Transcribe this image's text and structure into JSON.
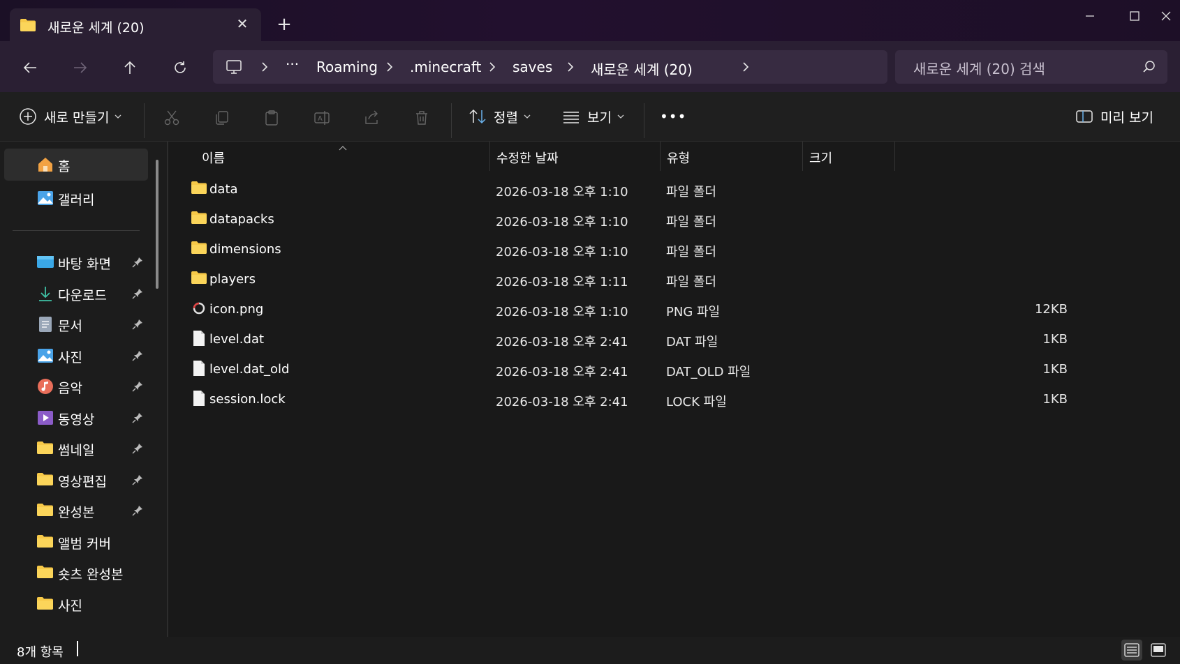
{
  "tab": {
    "title": "새로운 세계 (20)",
    "close": "✕",
    "new": "+"
  },
  "address": {
    "ellipsis": "···",
    "crumbs": [
      "Roaming",
      ".minecraft",
      "saves",
      "새로운 세계 (20)"
    ]
  },
  "search": {
    "placeholder": "새로운 세계 (20) 검색"
  },
  "toolbar": {
    "new_label": "새로 만들기",
    "sort_label": "정렬",
    "view_label": "보기",
    "more_label": "•••",
    "preview_label": "미리 보기"
  },
  "sidebar": {
    "items": [
      {
        "label": "홈",
        "icon": "home-icon",
        "pinned": false
      },
      {
        "label": "갤러리",
        "icon": "gallery-icon",
        "pinned": false
      },
      {
        "label": "바탕 화면",
        "icon": "desktop-icon",
        "pinned": true
      },
      {
        "label": "다운로드",
        "icon": "download-icon",
        "pinned": true
      },
      {
        "label": "문서",
        "icon": "documents-icon",
        "pinned": true
      },
      {
        "label": "사진",
        "icon": "pictures-icon",
        "pinned": true
      },
      {
        "label": "음악",
        "icon": "music-icon",
        "pinned": true
      },
      {
        "label": "동영상",
        "icon": "videos-icon",
        "pinned": true
      },
      {
        "label": "썸네일",
        "icon": "folder-icon",
        "pinned": true
      },
      {
        "label": "영상편집",
        "icon": "folder-icon",
        "pinned": true
      },
      {
        "label": "완성본",
        "icon": "folder-icon",
        "pinned": true
      },
      {
        "label": "앨범 커버",
        "icon": "folder-icon",
        "pinned": false
      },
      {
        "label": "숏츠 완성본",
        "icon": "folder-icon",
        "pinned": false
      },
      {
        "label": "사진",
        "icon": "folder-icon",
        "pinned": false
      }
    ]
  },
  "columns": {
    "name": "이름",
    "date": "수정한 날짜",
    "type": "유형",
    "size": "크기"
  },
  "files": [
    {
      "name": "data",
      "date": "2026-03-18 오후 1:10",
      "type": "파일 폴더",
      "size": "",
      "icon": "folder-icon"
    },
    {
      "name": "datapacks",
      "date": "2026-03-18 오후 1:10",
      "type": "파일 폴더",
      "size": "",
      "icon": "folder-icon"
    },
    {
      "name": "dimensions",
      "date": "2026-03-18 오후 1:10",
      "type": "파일 폴더",
      "size": "",
      "icon": "folder-icon"
    },
    {
      "name": "players",
      "date": "2026-03-18 오후 1:11",
      "type": "파일 폴더",
      "size": "",
      "icon": "folder-icon"
    },
    {
      "name": "icon.png",
      "date": "2026-03-18 오후 1:10",
      "type": "PNG 파일",
      "size": "12KB",
      "icon": "image-file-icon"
    },
    {
      "name": "level.dat",
      "date": "2026-03-18 오후 2:41",
      "type": "DAT 파일",
      "size": "1KB",
      "icon": "file-icon"
    },
    {
      "name": "level.dat_old",
      "date": "2026-03-18 오후 2:41",
      "type": "DAT_OLD 파일",
      "size": "1KB",
      "icon": "file-icon"
    },
    {
      "name": "session.lock",
      "date": "2026-03-18 오후 2:41",
      "type": "LOCK 파일",
      "size": "1KB",
      "icon": "file-icon"
    }
  ],
  "status": {
    "count": "8개 항목"
  },
  "colors": {
    "titlebar": "#1b1026",
    "navbar": "#2a1f33",
    "address": "#372b41",
    "folder": "#f7c948",
    "background": "#191919"
  }
}
